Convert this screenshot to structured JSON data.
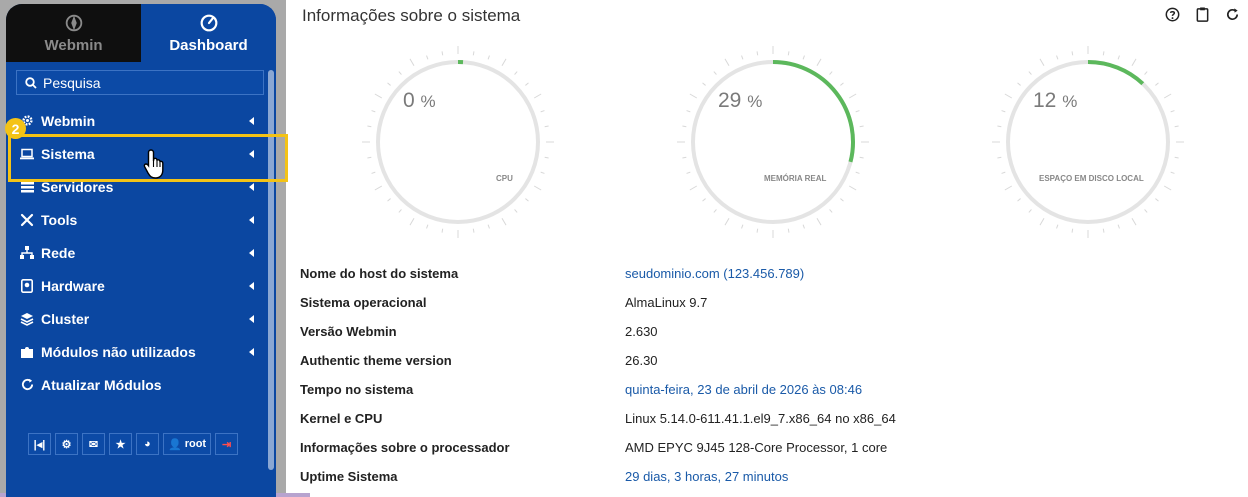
{
  "sidebar": {
    "tabs": [
      {
        "label": "Webmin",
        "icon": "webmin-logo-icon"
      },
      {
        "label": "Dashboard",
        "icon": "dashboard-icon"
      }
    ],
    "search_label": "Pesquisa",
    "items": [
      {
        "label": "Webmin",
        "icon": "gear-icon"
      },
      {
        "label": "Sistema",
        "icon": "laptop-icon"
      },
      {
        "label": "Servidores",
        "icon": "server-icon"
      },
      {
        "label": "Tools",
        "icon": "tools-icon"
      },
      {
        "label": "Rede",
        "icon": "network-icon"
      },
      {
        "label": "Hardware",
        "icon": "hdd-icon"
      },
      {
        "label": "Cluster",
        "icon": "layers-icon"
      },
      {
        "label": "Módulos não utilizados",
        "icon": "puzzle-icon"
      },
      {
        "label": "Atualizar Módulos",
        "icon": "refresh-icon"
      }
    ],
    "bottom_user": "root",
    "step_badge": "2"
  },
  "main": {
    "title": "Informações sobre o sistema",
    "gauges": [
      {
        "value": "0",
        "unit": "%",
        "label": "CPU",
        "percent": 0
      },
      {
        "value": "29",
        "unit": "%",
        "label": "MEMÓRIA REAL",
        "percent": 29
      },
      {
        "value": "12",
        "unit": "%",
        "label": "ESPAÇO EM DISCO LOCAL",
        "percent": 12
      }
    ],
    "info": [
      {
        "key": "Nome do host do sistema",
        "value": "seudominio.com (123.456.789)"
      },
      {
        "key": "Sistema operacional",
        "value": "AlmaLinux 9.7"
      },
      {
        "key": "Versão Webmin",
        "value": "2.630"
      },
      {
        "key": "Authentic theme version",
        "value": "26.30"
      },
      {
        "key": "Tempo no sistema",
        "value": "quinta-feira, 23 de abril de 2026 às 08:46"
      },
      {
        "key": "Kernel e CPU",
        "value": "Linux 5.14.0-611.41.1.el9_7.x86_64 no x86_64"
      },
      {
        "key": "Informações sobre o processador",
        "value": "AMD EPYC 9J45 128-Core Processor, 1 core"
      },
      {
        "key": "Uptime Sistema",
        "value": "29 dias, 3 horas, 27 minutos"
      }
    ]
  },
  "colors": {
    "sidebar": "#0b47a1",
    "gauge_fill": "#5cb85c",
    "highlight": "#f4c316",
    "link": "#1a5aa8"
  }
}
